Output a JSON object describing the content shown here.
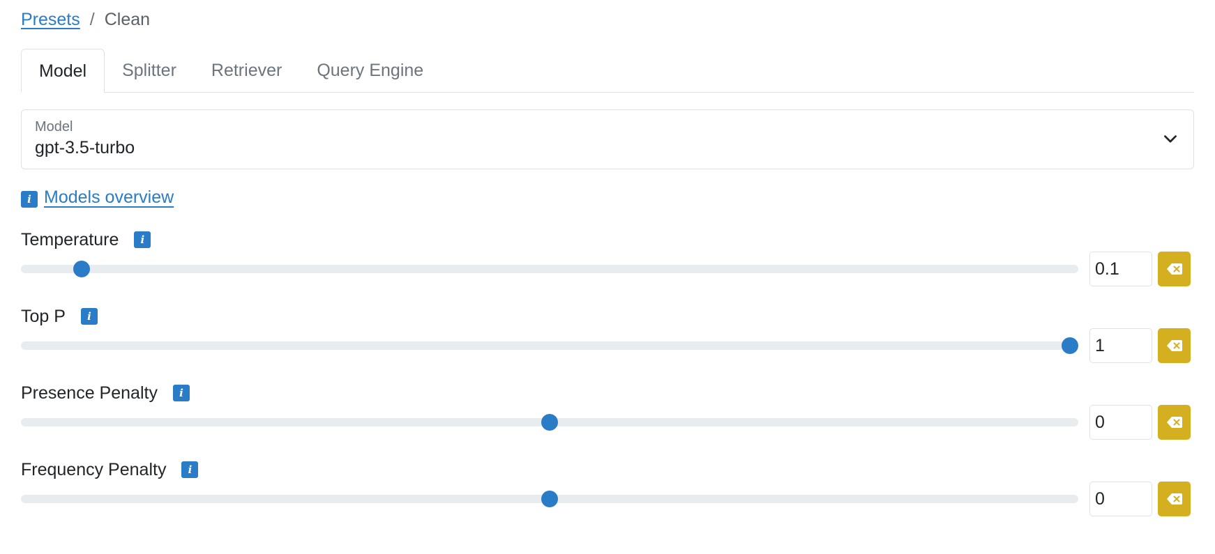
{
  "breadcrumb": {
    "parent": "Presets",
    "separator": "/",
    "current": "Clean"
  },
  "tabs": [
    {
      "label": "Model",
      "active": true
    },
    {
      "label": "Splitter",
      "active": false
    },
    {
      "label": "Retriever",
      "active": false
    },
    {
      "label": "Query Engine",
      "active": false
    }
  ],
  "model_select": {
    "label": "Model",
    "value": "gpt-3.5-turbo"
  },
  "overview": {
    "link": "Models overview"
  },
  "params": [
    {
      "label": "Temperature",
      "value": "0.1",
      "fraction": 0.05
    },
    {
      "label": "Top P",
      "value": "1",
      "fraction": 1.0
    },
    {
      "label": "Presence Penalty",
      "value": "0",
      "fraction": 0.5
    },
    {
      "label": "Frequency Penalty",
      "value": "0",
      "fraction": 0.5
    }
  ],
  "colors": {
    "accent": "#2a7cc7",
    "clear_button": "#d4b021",
    "track": "#e9ecef"
  },
  "icons": {
    "info": "info-icon",
    "chevron": "chevron-down-icon",
    "clear": "backspace-clear-icon"
  }
}
